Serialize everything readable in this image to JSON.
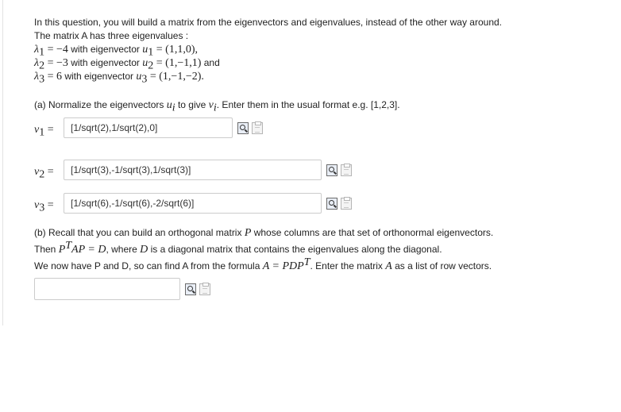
{
  "intro": {
    "line1": "In this question, you will build a matrix from the eigenvectors and eigenvalues, instead of the other way around.",
    "line2": "The matrix A has three eigenvalues :"
  },
  "eigen": [
    {
      "lambda": "λ",
      "sub": "1",
      "eq": " = −4",
      "text": " with eigenvector ",
      "u": "u",
      "usub": "1",
      "vec": " = (1,1,0),",
      "tail": ""
    },
    {
      "lambda": "λ",
      "sub": "2",
      "eq": " = −3",
      "text": " with eigenvector ",
      "u": "u",
      "usub": "2",
      "vec": " = (1,−1,1)",
      "tail": " and"
    },
    {
      "lambda": "λ",
      "sub": "3",
      "eq": " = 6",
      "text": " with eigenvector ",
      "u": "u",
      "usub": "3",
      "vec": " = (1,−1,−2).",
      "tail": ""
    }
  ],
  "part_a": {
    "prefix": "(a) Normalize the eigenvectors ",
    "u": "u",
    "usub": "i",
    "mid": " to give ",
    "v": "v",
    "vsub": "i",
    "suffix": ". Enter them in the usual format e.g. [1,2,3]."
  },
  "answers": [
    {
      "v": "v",
      "sub": "1",
      "eq": " =",
      "value": "[1/sqrt(2),1/sqrt(2),0]"
    },
    {
      "v": "v",
      "sub": "2",
      "eq": " =",
      "value": "[1/sqrt(3),-1/sqrt(3),1/sqrt(3)]"
    },
    {
      "v": "v",
      "sub": "3",
      "eq": " =",
      "value": "[1/sqrt(6),-1/sqrt(6),-2/sqrt(6)]"
    }
  ],
  "part_b": {
    "line1_pre": "(b) Recall that you can build an orthogonal matrix ",
    "P": "P",
    "line1_post": " whose columns are that set of orthonormal eigenvectors.",
    "line2_pre": "Then ",
    "PT": "P",
    "T": "T",
    "AP": "AP",
    "eqD": " = D",
    "line2_mid": ", where ",
    "D": "D",
    "line2_post": " is a diagonal matrix that contains the eigenvalues along the diagonal.",
    "line3_pre": "We now have P and D, so can find A from the formula ",
    "A": "A",
    "eqP": " = PDP",
    "T2": "T",
    "line3_mid": ". Enter the matrix ",
    "A2": "A",
    "line3_post": " as a list of row vectors.",
    "value": ""
  },
  "icons": {
    "preview": "preview-icon",
    "clipboard": "clipboard-icon"
  }
}
